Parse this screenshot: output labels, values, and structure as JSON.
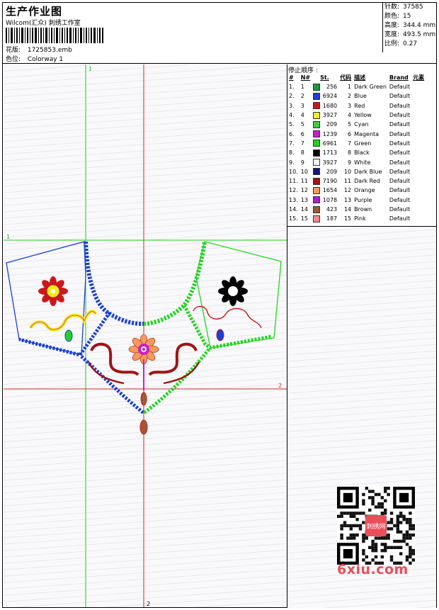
{
  "header": {
    "title": "生产作业图",
    "company": "Wilcom(汇众) 刺绣工作室",
    "design_label": "花版:",
    "design_value": "1725853.emb",
    "colorway_label": "色位:",
    "colorway_value": "Colorway 1"
  },
  "stats": {
    "stitches_label": "针数:",
    "stitches_value": "37585",
    "colors_label": "颜色:",
    "colors_value": "15",
    "height_label": "高度:",
    "height_value": "344.4 mm",
    "width_label": "宽度:",
    "width_value": "493.5 mm",
    "scale_label": "比例:",
    "scale_value": "0.27"
  },
  "canvas": {
    "guide_v1_label": "1",
    "guide_v2_label": "2",
    "guide_h1_label": "1",
    "guide_h2_label": "2"
  },
  "stop_sequence": {
    "title": "停止顺序 :",
    "columns": [
      "#",
      "N#",
      "St.",
      "代码",
      "描述",
      "Brand",
      "元素"
    ],
    "rows": [
      {
        "idx": "1.",
        "n": "1",
        "color": "#1a9a3a",
        "st": "256",
        "code": "1",
        "desc": "Dark Green",
        "brand": "Default"
      },
      {
        "idx": "2.",
        "n": "2",
        "color": "#1a3fd6",
        "st": "6924",
        "code": "2",
        "desc": "Blue",
        "brand": "Default"
      },
      {
        "idx": "3.",
        "n": "3",
        "color": "#c8191e",
        "st": "1680",
        "code": "3",
        "desc": "Red",
        "brand": "Default"
      },
      {
        "idx": "4.",
        "n": "4",
        "color": "#f2ee1c",
        "st": "3927",
        "code": "4",
        "desc": "Yellow",
        "brand": "Default"
      },
      {
        "idx": "5.",
        "n": "5",
        "color": "#3ccf3c",
        "st": "209",
        "code": "5",
        "desc": "Cyan",
        "brand": "Default"
      },
      {
        "idx": "6.",
        "n": "6",
        "color": "#c81ec8",
        "st": "1239",
        "code": "6",
        "desc": "Magenta",
        "brand": "Default"
      },
      {
        "idx": "7.",
        "n": "7",
        "color": "#22d322",
        "st": "6961",
        "code": "7",
        "desc": "Green",
        "brand": "Default"
      },
      {
        "idx": "8.",
        "n": "8",
        "color": "#000000",
        "st": "1713",
        "code": "8",
        "desc": "Black",
        "brand": "Default"
      },
      {
        "idx": "9.",
        "n": "9",
        "color": "#f4f4f4",
        "st": "3927",
        "code": "9",
        "desc": "White",
        "brand": "Default"
      },
      {
        "idx": "10.",
        "n": "10",
        "color": "#14147a",
        "st": "209",
        "code": "10",
        "desc": "Dark Blue",
        "brand": "Default"
      },
      {
        "idx": "11.",
        "n": "11",
        "color": "#a01414",
        "st": "7190",
        "code": "11",
        "desc": "Dark Red",
        "brand": "Default"
      },
      {
        "idx": "12.",
        "n": "12",
        "color": "#f59a5a",
        "st": "1654",
        "code": "12",
        "desc": "Orange",
        "brand": "Default"
      },
      {
        "idx": "13.",
        "n": "13",
        "color": "#b01ec8",
        "st": "1078",
        "code": "13",
        "desc": "Purple",
        "brand": "Default"
      },
      {
        "idx": "14.",
        "n": "14",
        "color": "#a05a32",
        "st": "423",
        "code": "14",
        "desc": "Brown",
        "brand": "Default"
      },
      {
        "idx": "15.",
        "n": "15",
        "color": "#f08c96",
        "st": "187",
        "code": "15",
        "desc": "Pink",
        "brand": "Default"
      }
    ]
  },
  "watermark": {
    "site": "6xiu.com",
    "stamp_text": "刺绣网"
  },
  "icons": {
    "barcode": "barcode-icon",
    "qr": "qr-code-icon"
  }
}
